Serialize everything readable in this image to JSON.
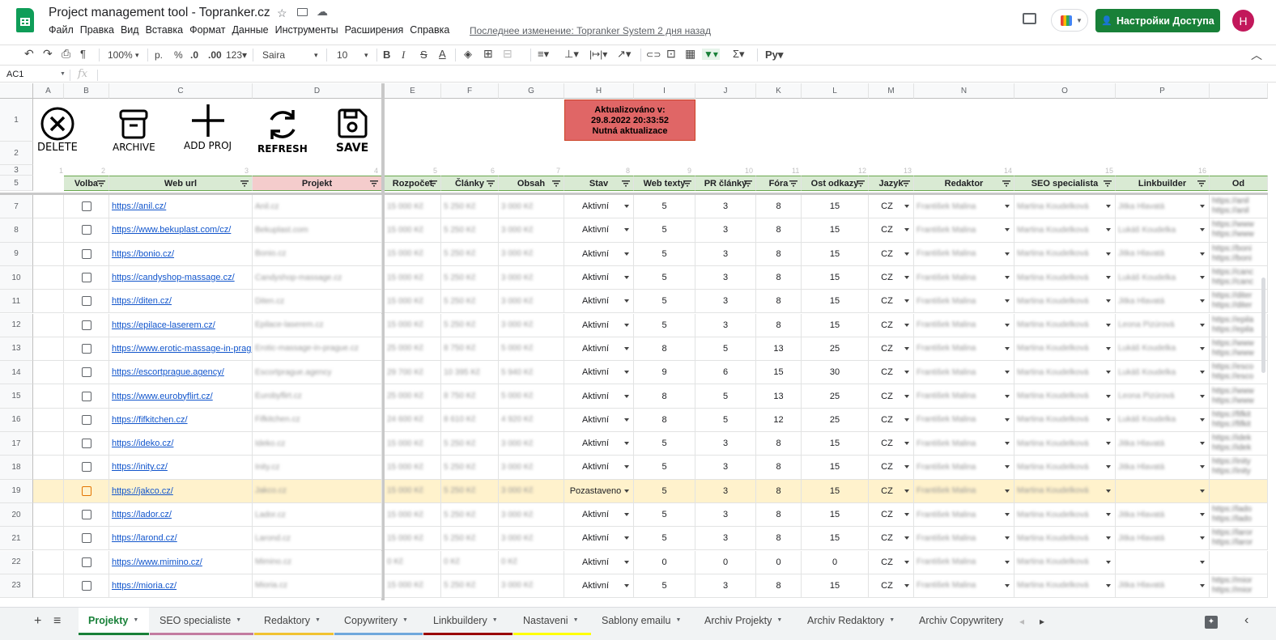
{
  "app": {
    "title": "Project management tool - Topranker.cz",
    "star_icon": "☆",
    "folder_icon": "▭",
    "cloud_icon": "☁",
    "last_edit": "Последнее изменение: Topranker System 2 дня назад",
    "share_label": "Настройки Доступа",
    "share_icon": "👤",
    "avatar_letter": "H"
  },
  "menu": [
    "Файл",
    "Правка",
    "Вид",
    "Вставка",
    "Формат",
    "Данные",
    "Инструменты",
    "Расширения",
    "Справка"
  ],
  "toolbar": {
    "undo": "↶",
    "redo": "↷",
    "print": "⎙",
    "paint": "¶",
    "zoom": "100%",
    "zoom_caret": "▾",
    "currency": "р.",
    "percent": "%",
    "dec_less": ".0",
    "dec_more": ".00",
    "format123": "123▾",
    "font": "Saira",
    "font_caret": "▾",
    "size": "10",
    "size_caret": "▾",
    "bold": "B",
    "italic": "I",
    "strike": "S",
    "textcolor": "A",
    "fill": "◈",
    "borders": "⊞",
    "merge": "⊟",
    "halign": "≡▾",
    "valign": "⊥▾",
    "wrap": "|↦|▾",
    "rotate": "↗▾",
    "link": "⊂⊃",
    "comment": "⊡",
    "chart": "▦",
    "filter": "▼▾",
    "func": "Σ▾",
    "input": "Рy▾",
    "collapse": "︿"
  },
  "formula": {
    "namebox": "AC1",
    "caret": "▼",
    "fx": "fx"
  },
  "columns": [
    "A",
    "B",
    "C",
    "D",
    "E",
    "F",
    "G",
    "H",
    "I",
    "J",
    "K",
    "L",
    "M",
    "N",
    "O",
    "P"
  ],
  "ghost_numbers": [
    "1",
    "2",
    "3",
    "4",
    "5",
    "6",
    "7",
    "8",
    "9",
    "10",
    "11",
    "12",
    "13",
    "14",
    "15",
    "16"
  ],
  "row_numbers": [
    "1",
    "2",
    "3",
    "5",
    "7",
    "8",
    "9",
    "10",
    "11",
    "12",
    "13",
    "14",
    "15",
    "16",
    "17",
    "18",
    "19",
    "20",
    "21",
    "22",
    "23"
  ],
  "actions": [
    {
      "label": "DELETE",
      "icon": "delete-icon"
    },
    {
      "label": "ARCHIVE",
      "icon": "archive-icon"
    },
    {
      "label": "ADD PROJ",
      "icon": "plus-icon"
    },
    {
      "label": "REFRESH",
      "icon": "refresh-icon"
    },
    {
      "label": "SAVE",
      "icon": "save-icon"
    }
  ],
  "banner": {
    "line1": "Aktualizováno v:",
    "line2": "29.8.2022 20:33:52",
    "line3": "Nutná aktualizace",
    "color": "#e06666"
  },
  "headers": [
    "Volba",
    "Web url",
    "Projekt",
    "Rozpočet",
    "Články",
    "Obsah",
    "Stav",
    "Web texty",
    "PR články",
    "Fóra",
    "Ost odkazy",
    "Jazyk",
    "Redaktor",
    "SEO specialista",
    "Linkbuilder",
    "Od"
  ],
  "rows": [
    {
      "row": "7",
      "url": "https://anil.cz/",
      "proj": "Anil.cz",
      "rozp": "15 000 Kč",
      "cl": "5 250 Kč",
      "obs": "3 000 Kč",
      "stav": "Aktivní",
      "web": "5",
      "pr": "3",
      "fora": "8",
      "ost": "15",
      "jazyk": "CZ",
      "red": "František Malina",
      "seo": "Martina Koudelková",
      "lb": "Jitka Hlavatá",
      "od1": "https://anil",
      "od2": "https://anil"
    },
    {
      "row": "8",
      "url": "https://www.bekuplast.com/cz/",
      "proj": "Bekuplast.com",
      "rozp": "15 000 Kč",
      "cl": "5 250 Kč",
      "obs": "3 000 Kč",
      "stav": "Aktivní",
      "web": "5",
      "pr": "3",
      "fora": "8",
      "ost": "15",
      "jazyk": "CZ",
      "red": "František Malina",
      "seo": "Martina Koudelková",
      "lb": "Lukáš Koudelka",
      "od1": "https://www",
      "od2": "https://www"
    },
    {
      "row": "9",
      "url": "https://bonio.cz/",
      "proj": "Bonio.cz",
      "rozp": "15 000 Kč",
      "cl": "5 250 Kč",
      "obs": "3 000 Kč",
      "stav": "Aktivní",
      "web": "5",
      "pr": "3",
      "fora": "8",
      "ost": "15",
      "jazyk": "CZ",
      "red": "František Malina",
      "seo": "Martina Koudelková",
      "lb": "Jitka Hlavatá",
      "od1": "https://boni",
      "od2": "https://boni"
    },
    {
      "row": "10",
      "url": "https://candyshop-massage.cz/",
      "proj": "Candyshop-massage.cz",
      "rozp": "15 000 Kč",
      "cl": "5 250 Kč",
      "obs": "3 000 Kč",
      "stav": "Aktivní",
      "web": "5",
      "pr": "3",
      "fora": "8",
      "ost": "15",
      "jazyk": "CZ",
      "red": "František Malina",
      "seo": "Martina Koudelková",
      "lb": "Lukáš Koudelka",
      "od1": "https://canc",
      "od2": "https://canc"
    },
    {
      "row": "11",
      "url": "https://diten.cz/",
      "proj": "Diten.cz",
      "rozp": "15 000 Kč",
      "cl": "5 250 Kč",
      "obs": "3 000 Kč",
      "stav": "Aktivní",
      "web": "5",
      "pr": "3",
      "fora": "8",
      "ost": "15",
      "jazyk": "CZ",
      "red": "František Malina",
      "seo": "Martina Koudelková",
      "lb": "Jitka Hlavatá",
      "od1": "https://diter",
      "od2": "https://diter"
    },
    {
      "row": "12",
      "url": "https://epilace-laserem.cz/",
      "proj": "Epilace-laserem.cz",
      "rozp": "15 000 Kč",
      "cl": "5 250 Kč",
      "obs": "3 000 Kč",
      "stav": "Aktivní",
      "web": "5",
      "pr": "3",
      "fora": "8",
      "ost": "15",
      "jazyk": "CZ",
      "red": "František Malina",
      "seo": "Martina Koudelková",
      "lb": "Leona Pizúrová",
      "od1": "https://epila",
      "od2": "https://epila"
    },
    {
      "row": "13",
      "url": "https://www.erotic-massage-in-prague.cz/",
      "proj": "Erotic-massage-in-prague.cz",
      "rozp": "25 000 Kč",
      "cl": "8 750 Kč",
      "obs": "5 000 Kč",
      "stav": "Aktivní",
      "web": "8",
      "pr": "5",
      "fora": "13",
      "ost": "25",
      "jazyk": "CZ",
      "red": "František Malina",
      "seo": "Martina Koudelková",
      "lb": "Lukáš Koudelka",
      "od1": "https://www",
      "od2": "https://www"
    },
    {
      "row": "14",
      "url": "https://escortprague.agency/",
      "proj": "Escortprague.agency",
      "rozp": "29 700 Kč",
      "cl": "10 395 Kč",
      "obs": "5 940 Kč",
      "stav": "Aktivní",
      "web": "9",
      "pr": "6",
      "fora": "15",
      "ost": "30",
      "jazyk": "CZ",
      "red": "František Malina",
      "seo": "Martina Koudelková",
      "lb": "Lukáš Koudelka",
      "od1": "https://esco",
      "od2": "https://esco"
    },
    {
      "row": "15",
      "url": "https://www.eurobyflirt.cz/",
      "proj": "Eurobyflirt.cz",
      "rozp": "25 000 Kč",
      "cl": "8 750 Kč",
      "obs": "5 000 Kč",
      "stav": "Aktivní",
      "web": "8",
      "pr": "5",
      "fora": "13",
      "ost": "25",
      "jazyk": "CZ",
      "red": "František Malina",
      "seo": "Martina Koudelková",
      "lb": "Leona Pizúrová",
      "od1": "https://www",
      "od2": "https://www"
    },
    {
      "row": "16",
      "url": "https://fifkitchen.cz/",
      "proj": "Fifkitchen.cz",
      "rozp": "24 600 Kč",
      "cl": "8 610 Kč",
      "obs": "4 920 Kč",
      "stav": "Aktivní",
      "web": "8",
      "pr": "5",
      "fora": "12",
      "ost": "25",
      "jazyk": "CZ",
      "red": "František Malina",
      "seo": "Martina Koudelková",
      "lb": "Lukáš Koudelka",
      "od1": "https://fifkit",
      "od2": "https://fifkit"
    },
    {
      "row": "17",
      "url": "https://ideko.cz/",
      "proj": "Ideko.cz",
      "rozp": "15 000 Kč",
      "cl": "5 250 Kč",
      "obs": "3 000 Kč",
      "stav": "Aktivní",
      "web": "5",
      "pr": "3",
      "fora": "8",
      "ost": "15",
      "jazyk": "CZ",
      "red": "František Malina",
      "seo": "Martina Koudelková",
      "lb": "Jitka Hlavatá",
      "od1": "https://idek",
      "od2": "https://idek"
    },
    {
      "row": "18",
      "url": "https://inity.cz/",
      "proj": "Inity.cz",
      "rozp": "15 000 Kč",
      "cl": "5 250 Kč",
      "obs": "3 000 Kč",
      "stav": "Aktivní",
      "web": "5",
      "pr": "3",
      "fora": "8",
      "ost": "15",
      "jazyk": "CZ",
      "red": "František Malina",
      "seo": "Martina Koudelková",
      "lb": "Jitka Hlavatá",
      "od1": "https://inity",
      "od2": "https://inity"
    },
    {
      "row": "19",
      "url": "https://jakco.cz/",
      "proj": "Jakco.cz",
      "rozp": "15 000 Kč",
      "cl": "5 250 Kč",
      "obs": "3 000 Kč",
      "stav": "Pozastaveno",
      "web": "5",
      "pr": "3",
      "fora": "8",
      "ost": "15",
      "jazyk": "CZ",
      "red": "František Malina",
      "seo": "Martina Koudelková",
      "lb": "",
      "od1": "",
      "od2": "",
      "paused": true
    },
    {
      "row": "20",
      "url": "https://lador.cz/",
      "proj": "Lador.cz",
      "rozp": "15 000 Kč",
      "cl": "5 250 Kč",
      "obs": "3 000 Kč",
      "stav": "Aktivní",
      "web": "5",
      "pr": "3",
      "fora": "8",
      "ost": "15",
      "jazyk": "CZ",
      "red": "František Malina",
      "seo": "Martina Koudelková",
      "lb": "Jitka Hlavatá",
      "od1": "https://lado",
      "od2": "https://lado"
    },
    {
      "row": "21",
      "url": "https://larond.cz/",
      "proj": "Larond.cz",
      "rozp": "15 000 Kč",
      "cl": "5 250 Kč",
      "obs": "3 000 Kč",
      "stav": "Aktivní",
      "web": "5",
      "pr": "3",
      "fora": "8",
      "ost": "15",
      "jazyk": "CZ",
      "red": "František Malina",
      "seo": "Martina Koudelková",
      "lb": "Jitka Hlavatá",
      "od1": "https://laror",
      "od2": "https://laror"
    },
    {
      "row": "22",
      "url": "https://www.mimino.cz/",
      "proj": "Mimino.cz",
      "rozp": "0 Kč",
      "cl": "0 Kč",
      "obs": "0 Kč",
      "stav": "Aktivní",
      "web": "0",
      "pr": "0",
      "fora": "0",
      "ost": "0",
      "jazyk": "CZ",
      "red": "František Malina",
      "seo": "Martina Koudelková",
      "lb": "",
      "od1": "",
      "od2": ""
    },
    {
      "row": "23",
      "url": "https://mioria.cz/",
      "proj": "Mioria.cz",
      "rozp": "15 000 Kč",
      "cl": "5 250 Kč",
      "obs": "3 000 Kč",
      "stav": "Aktivní",
      "web": "5",
      "pr": "3",
      "fora": "8",
      "ost": "15",
      "jazyk": "CZ",
      "red": "František Malina",
      "seo": "Martina Koudelková",
      "lb": "Jitka Hlavatá",
      "od1": "https://mior",
      "od2": "https://mior"
    }
  ],
  "sheets": {
    "add": "+",
    "list": "≡",
    "tabs": [
      {
        "label": "Projekty",
        "color": "#188038",
        "active": true
      },
      {
        "label": "SEO specialiste",
        "color": "#c27ba0"
      },
      {
        "label": "Redaktory",
        "color": "#f1c232"
      },
      {
        "label": "Copywritery",
        "color": "#6fa8dc"
      },
      {
        "label": "Linkbuildery",
        "color": "#990000"
      },
      {
        "label": "Nastaveni",
        "color": "#ffff00"
      },
      {
        "label": "Sablony emailu",
        "color": ""
      },
      {
        "label": "Archiv Projekty",
        "color": ""
      },
      {
        "label": "Archiv Redaktory",
        "color": ""
      },
      {
        "label": "Archiv Copywritery",
        "color": ""
      }
    ],
    "prev": "◂",
    "next": "▸",
    "explore": "✦",
    "collapse": "‹"
  },
  "colors": {
    "header_green": "#d9ead3",
    "header_pink": "#f4cccc",
    "paused_row": "#fff2cc",
    "share_green": "#188038"
  }
}
